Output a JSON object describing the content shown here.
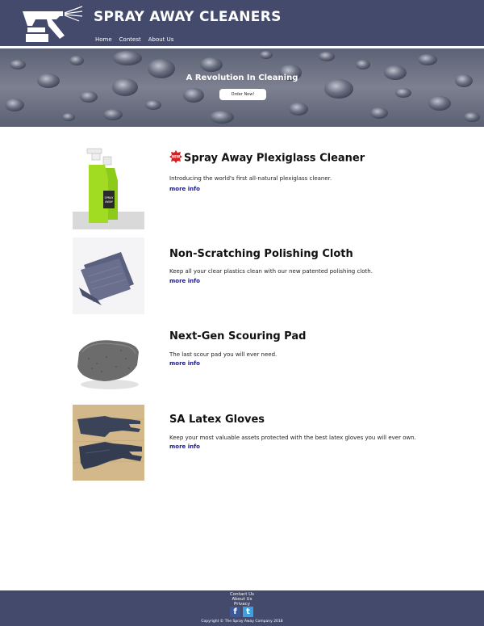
{
  "header": {
    "brand": "SPRAY AWAY CLEANERS",
    "nav": [
      "Home",
      "Contest",
      "About Us"
    ]
  },
  "hero": {
    "title": "A Revolution In Cleaning",
    "button": "Order Now!"
  },
  "products": [
    {
      "badge": "NEW",
      "title": "Spray Away Plexiglass Cleaner",
      "description": "Introducing the world's first all-natural plexiglass cleaner.",
      "more": "more info",
      "image_label": "SPRAY AWAY"
    },
    {
      "title": "Non-Scratching Polishing Cloth",
      "description": "Keep all your clear plastics clean with our new patented polishing cloth.",
      "more": "more info"
    },
    {
      "title": "Next-Gen Scouring Pad",
      "description": "The last scour pad you will ever need.",
      "more": "more info"
    },
    {
      "title": "SA Latex Gloves",
      "description": "Keep your most valuable assets protected with the best latex gloves you will ever own.",
      "more": "more info"
    }
  ],
  "footer": {
    "links": [
      "Contact Us",
      "About Us",
      "Privacy"
    ],
    "social": [
      "f",
      "t"
    ],
    "copyright": "Copyright © The Spray Away Company 2018"
  },
  "colors": {
    "header_bg": "#444a6b",
    "link": "#1a1a8c"
  }
}
